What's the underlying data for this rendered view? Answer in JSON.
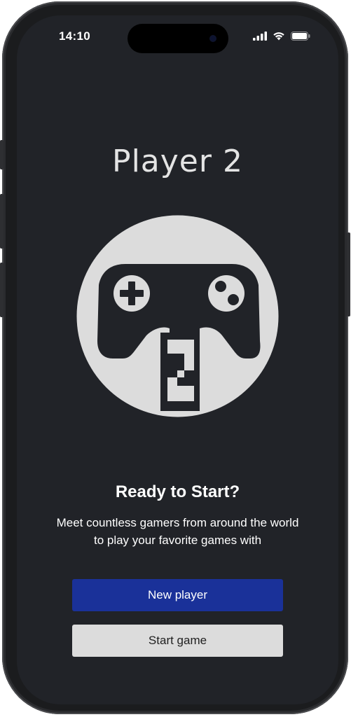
{
  "status_bar": {
    "time": "14:10",
    "icons": [
      "cellular-signal-icon",
      "wifi-icon",
      "battery-icon"
    ]
  },
  "screen": {
    "title": "Player 2",
    "emblem_icon": "gamepad-player-2-icon",
    "heading": "Ready to Start?",
    "description": "Meet countless gamers from around the world to play your favorite games with"
  },
  "buttons": {
    "new_player": "New player",
    "start_game": "Start game"
  },
  "colors": {
    "background": "#212328",
    "primary_button": "#1a3199",
    "secondary_button": "#dcdcdc",
    "emblem": "#dcdcdc"
  }
}
